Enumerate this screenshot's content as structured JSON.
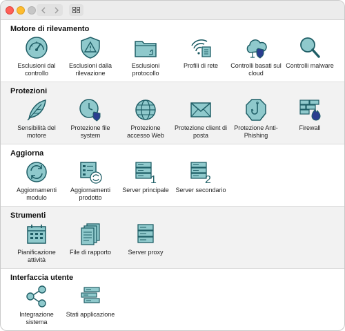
{
  "window": {
    "buttons": [
      "close",
      "minimize",
      "zoom"
    ],
    "toolbar": {
      "back_icon": "chevron-left-icon",
      "forward_icon": "chevron-right-icon",
      "grid_icon": "grid-icon"
    }
  },
  "colors": {
    "icon_fill": "#8fc9cc",
    "icon_stroke": "#1f5e66",
    "section_alt_bg": "#f2f2f2",
    "badge_blue": "#2a3e8f"
  },
  "sections": [
    {
      "title": "Motore di rilevamento",
      "items": [
        {
          "label": "Esclusioni dal controllo",
          "icon": "speedometer-icon"
        },
        {
          "label": "Esclusioni dalla rilevazione",
          "icon": "warning-shield-icon"
        },
        {
          "label": "Esclusioni protocollo",
          "icon": "folder-icon"
        },
        {
          "label": "Profili di rete",
          "icon": "wifi-network-icon"
        },
        {
          "label": "Controlli basati sul cloud",
          "icon": "cloud-shield-icon"
        },
        {
          "label": "Controlli malware",
          "icon": "magnifier-icon"
        }
      ]
    },
    {
      "title": "Protezioni",
      "items": [
        {
          "label": "Sensibilità del motore",
          "icon": "feather-icon"
        },
        {
          "label": "Protezione file system",
          "icon": "clock-shield-icon"
        },
        {
          "label": "Protezione accesso Web",
          "icon": "globe-icon"
        },
        {
          "label": "Protezione client di posta",
          "icon": "envelope-icon"
        },
        {
          "label": "Protezione Anti-Phishing",
          "icon": "fishhook-icon"
        },
        {
          "label": "Firewall",
          "icon": "firewall-icon"
        }
      ]
    },
    {
      "title": "Aggiorna",
      "items": [
        {
          "label": "Aggiornamenti modulo",
          "icon": "refresh-icon"
        },
        {
          "label": "Aggiornamenti prodotto",
          "icon": "product-update-icon"
        },
        {
          "label": "Server principale",
          "icon": "server-1-icon",
          "badge": "1"
        },
        {
          "label": "Server secondario",
          "icon": "server-2-icon",
          "badge": "2"
        }
      ]
    },
    {
      "title": "Strumenti",
      "items": [
        {
          "label": "Pianificazione attività",
          "icon": "calendar-icon"
        },
        {
          "label": "File di rapporto",
          "icon": "documents-icon"
        },
        {
          "label": "Server proxy",
          "icon": "server-proxy-icon"
        }
      ]
    },
    {
      "title": "Interfaccia utente",
      "items": [
        {
          "label": "Integrazione sistema",
          "icon": "share-nodes-icon"
        },
        {
          "label": "Stati applicazione",
          "icon": "status-bars-icon"
        }
      ]
    }
  ]
}
